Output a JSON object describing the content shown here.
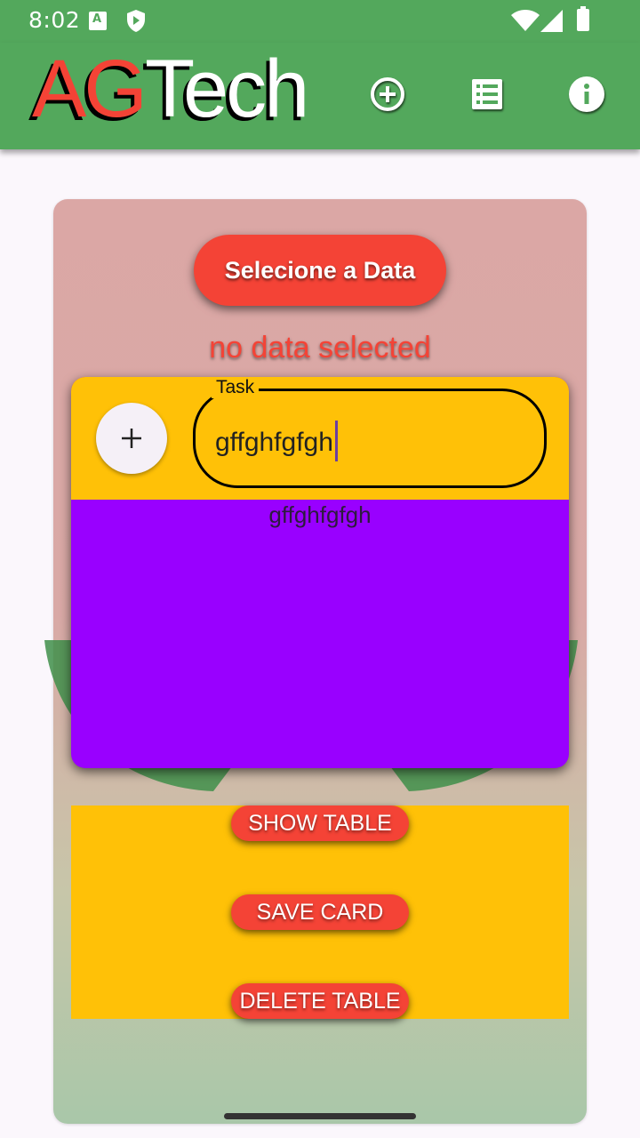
{
  "status_bar": {
    "time": "8:02",
    "notification_icons": [
      "font-notification-icon",
      "shield-play-icon"
    ],
    "system_icons": [
      "wifi-icon",
      "cell-signal-icon",
      "battery-icon"
    ]
  },
  "app_bar": {
    "logo_part1": "AG",
    "logo_part2": "Tech",
    "actions": [
      "add-circle-icon",
      "list-icon",
      "info-icon"
    ],
    "colors": {
      "background": "#53a85c",
      "logo_accent": "#f44336"
    }
  },
  "main": {
    "date_button_label": "Selecione a Data",
    "no_data_text": "no data selected",
    "task": {
      "field_label": "Task",
      "field_value": "gffghfgfgh",
      "preview_text": "gffghfgfgh",
      "add_icon": "plus-icon"
    },
    "actions": {
      "show_table": "SHOW TABLE",
      "save_card": "SAVE CARD",
      "delete_table": "DELETE TABLE"
    },
    "colors": {
      "button": "#f44336",
      "task_header": "#ffc107",
      "task_body": "#9900ff",
      "actions_panel": "#ffc107"
    }
  }
}
